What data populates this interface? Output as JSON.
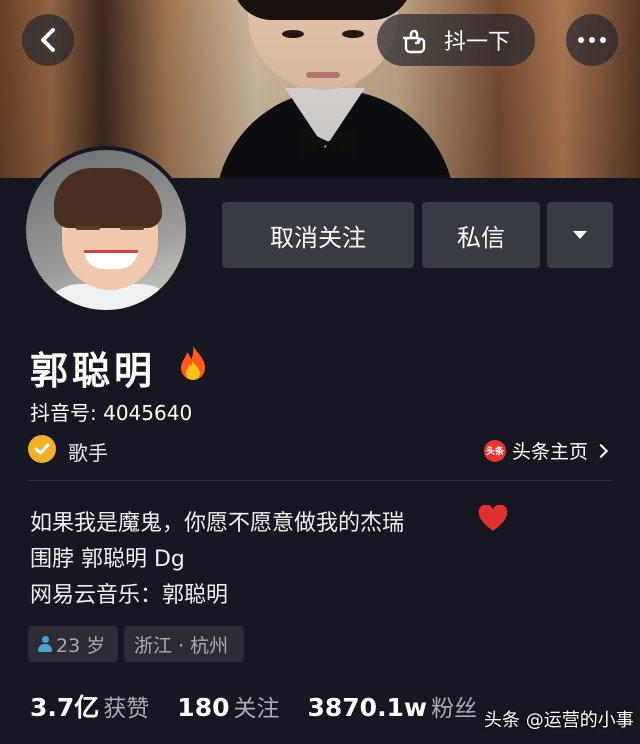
{
  "header": {
    "poke_label": "抖一下"
  },
  "actions": {
    "unfollow_label": "取消关注",
    "message_label": "私信"
  },
  "profile": {
    "name": "郭聪明",
    "douyin_id": "抖音号: 4045640",
    "verified_role": "歌手",
    "toutiao_link": "头条主页",
    "toutiao_logo_text": "头条"
  },
  "bio": {
    "line1": "如果我是魔鬼，你愿不愿意做我的杰瑞",
    "line2": "围脖 郭聪明 Dg",
    "line3": "网易云音乐：郭聪明"
  },
  "tags": {
    "age": "23 岁",
    "location": "浙江 · 杭州"
  },
  "stats": [
    {
      "value": "3.7亿",
      "label": "获赞"
    },
    {
      "value": "180",
      "label": "关注"
    },
    {
      "value": "3870.1w",
      "label": "粉丝"
    }
  ],
  "watermark": "头条 @运营的小事",
  "icons": {
    "back": "chevron-left-icon",
    "poke": "hand-point-icon",
    "more": "more-dots-icon",
    "dropdown": "caret-down-icon",
    "fire": "fire-icon",
    "verified": "verified-check-icon",
    "heart": "heart-icon",
    "age": "person-icon"
  },
  "colors": {
    "background": "#161722",
    "button": "#393b44",
    "verified": "#f3b12a",
    "toutiao_red": "#e8382d",
    "heart": "#e0312f"
  }
}
